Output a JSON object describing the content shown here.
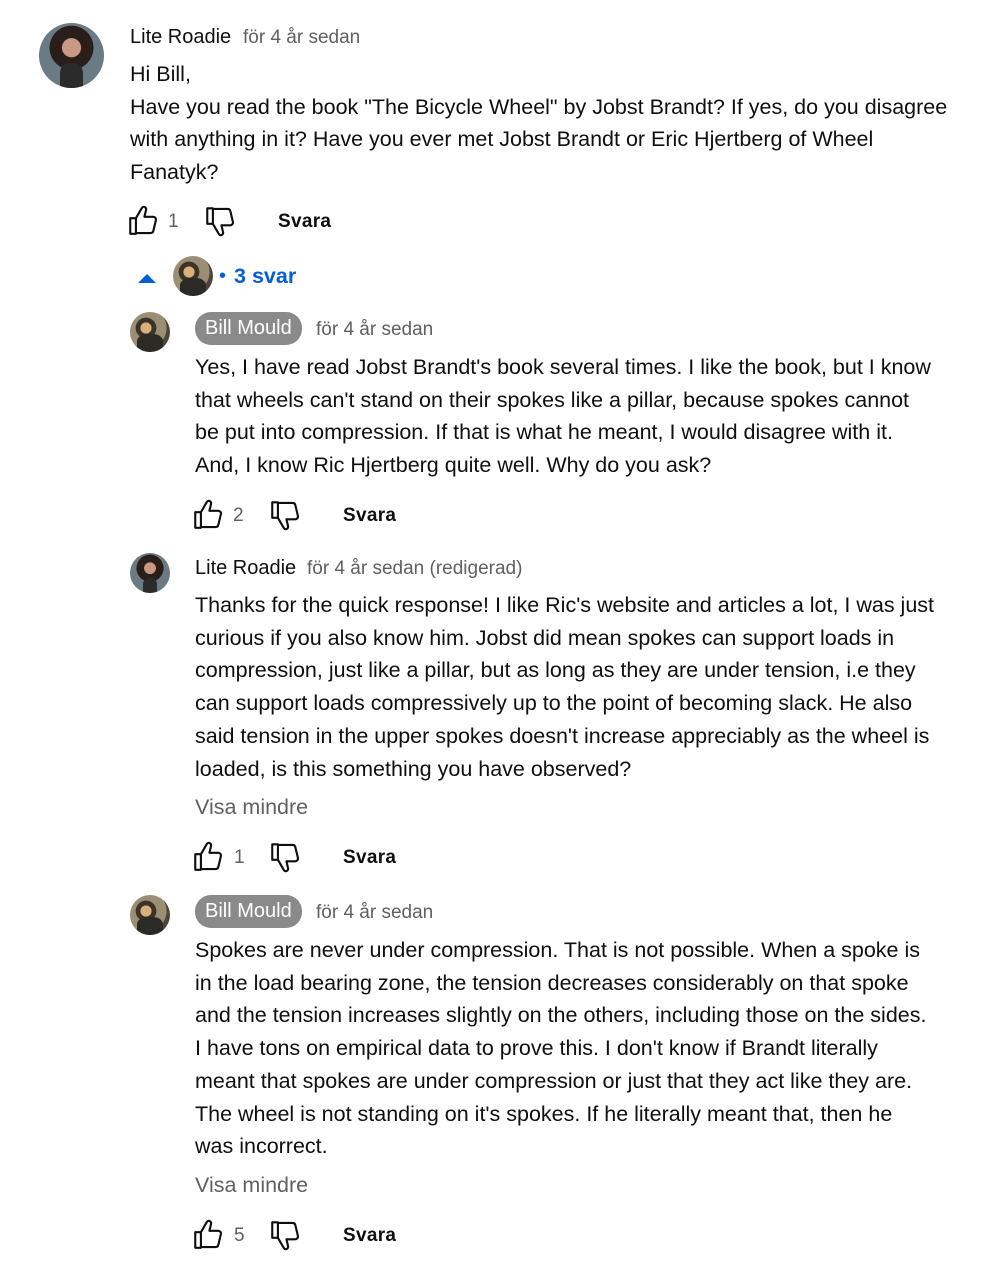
{
  "comment": {
    "author": "Lite Roadie",
    "time": "för 4 år sedan",
    "lines": [
      "Hi Bill,",
      "Have you read the book \"The Bicycle Wheel\" by Jobst Brandt? If yes, do you disagree",
      "with anything in it? Have you ever met Jobst Brandt or Eric Hjertberg of Wheel",
      "Fanatyk?"
    ],
    "likes": "1",
    "reply_label": "Svara",
    "avatar_icon": "user-avatar-lite-roadie"
  },
  "replies_toggle": {
    "label": "3 svar",
    "dot": "•",
    "caret_icon": "caret-up-icon"
  },
  "replies": [
    {
      "author": "Bill Mould",
      "time": "för 4 år sedan",
      "lines": [
        "Yes, I have read Jobst Brandt's book several times.  I like the book, but I know",
        "that wheels can't stand on their spokes like a pillar, because spokes cannot",
        "be put into compression.  If that is what he meant, I would disagree with it.",
        "And, I know Ric Hjertberg quite well.   Why do you ask?"
      ],
      "likes": "2",
      "reply_label": "Svara"
    },
    {
      "author": "Lite Roadie",
      "time": "för 4 år sedan (redigerad)",
      "lines": [
        "Thanks for the quick response! I like Ric's website and articles a lot, I was just",
        "curious if you also know him. Jobst did mean spokes can support loads in",
        "compression, just like a pillar, but as long as they are under tension, i.e they",
        "can support loads compressively up to the point of becoming slack. He also",
        "said tension in the upper spokes doesn't increase appreciably as the wheel is",
        "loaded, is this something you have observed?"
      ],
      "show_less": "Visa mindre",
      "likes": "1",
      "reply_label": "Svara"
    },
    {
      "author": "Bill Mould",
      "time": "för 4 år sedan",
      "lines": [
        "Spokes are never under compression.  That is not possible.  When a spoke is",
        "in the load bearing zone, the tension decreases considerably on that spoke",
        "and the tension increases slightly on the others, including those on the sides.",
        "I have tons on empirical data to prove this.  I don't know if Brandt literally",
        "meant that spokes are under compression or just that they act like they are.",
        "The wheel is not standing on it's spokes.  If he literally meant that, then he",
        "was incorrect."
      ],
      "show_less": "Visa mindre",
      "likes": "5",
      "reply_label": "Svara"
    }
  ],
  "colors": {
    "link_blue": "#065fd4",
    "secondary_text": "#606060",
    "owner_chip": "#8a8a8a"
  }
}
